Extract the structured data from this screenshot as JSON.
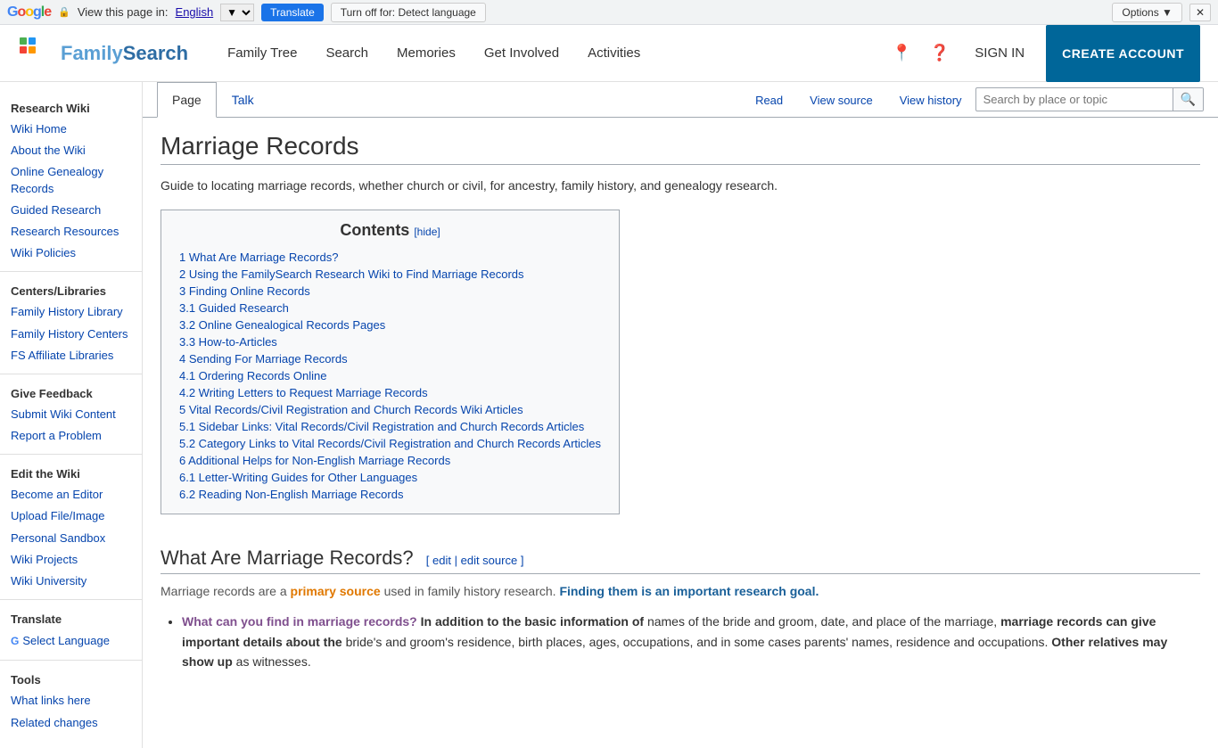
{
  "translate_bar": {
    "view_text": "View this page in:",
    "language": "English",
    "translate_btn": "Translate",
    "turn_off_btn": "Turn off for: Detect language",
    "options_btn": "Options ▼",
    "close_btn": "✕"
  },
  "header": {
    "logo_text": "FamilySearch",
    "nav_items": [
      "Family Tree",
      "Search",
      "Memories",
      "Get Involved",
      "Activities"
    ],
    "sign_in": "SIGN IN",
    "create_account": "CREATE ACCOUNT"
  },
  "sidebar": {
    "sections": [
      {
        "title": "Research Wiki",
        "links": [
          {
            "label": "Wiki Home",
            "href": "#"
          },
          {
            "label": "About the Wiki",
            "href": "#"
          },
          {
            "label": "Online Genealogy Records",
            "href": "#"
          },
          {
            "label": "Guided Research",
            "href": "#"
          },
          {
            "label": "Research Resources",
            "href": "#"
          },
          {
            "label": "Wiki Policies",
            "href": "#"
          }
        ]
      },
      {
        "title": "Centers/Libraries",
        "links": [
          {
            "label": "Family History Library",
            "href": "#"
          },
          {
            "label": "Family History Centers",
            "href": "#"
          },
          {
            "label": "FS Affiliate Libraries",
            "href": "#"
          }
        ]
      },
      {
        "title": "Give Feedback",
        "links": [
          {
            "label": "Submit Wiki Content",
            "href": "#"
          },
          {
            "label": "Report a Problem",
            "href": "#"
          }
        ]
      },
      {
        "title": "Edit the Wiki",
        "links": [
          {
            "label": "Become an Editor",
            "href": "#"
          },
          {
            "label": "Upload File/Image",
            "href": "#"
          },
          {
            "label": "Personal Sandbox",
            "href": "#"
          },
          {
            "label": "Wiki Projects",
            "href": "#"
          },
          {
            "label": "Wiki University",
            "href": "#"
          }
        ]
      },
      {
        "title": "Translate",
        "links": [
          {
            "label": "Select Language",
            "href": "#"
          }
        ]
      },
      {
        "title": "Tools",
        "links": [
          {
            "label": "What links here",
            "href": "#"
          },
          {
            "label": "Related changes",
            "href": "#"
          }
        ]
      }
    ]
  },
  "page_tabs": {
    "left": [
      {
        "label": "Page",
        "active": true
      },
      {
        "label": "Talk",
        "active": false
      }
    ],
    "right": [
      {
        "label": "Read"
      },
      {
        "label": "View source"
      },
      {
        "label": "View history"
      }
    ],
    "search_placeholder": "Search by place or topic"
  },
  "article": {
    "title": "Marriage Records",
    "intro": "Guide to locating marriage records, whether church or civil, for ancestry, family history, and genealogy research.",
    "contents": {
      "title": "Contents",
      "hide_label": "[hide]",
      "items": [
        {
          "num": "1",
          "label": "What Are Marriage Records?",
          "href": "#"
        },
        {
          "num": "2",
          "label": "Using the FamilySearch Research Wiki to Find Marriage Records",
          "href": "#"
        },
        {
          "num": "3",
          "label": "Finding Online Records",
          "href": "#"
        },
        {
          "num": "3.1",
          "label": "Guided Research",
          "href": "#",
          "sub": true
        },
        {
          "num": "3.2",
          "label": "Online Genealogical Records Pages",
          "href": "#",
          "sub": true
        },
        {
          "num": "3.3",
          "label": "How-to-Articles",
          "href": "#",
          "sub": true
        },
        {
          "num": "4",
          "label": "Sending For Marriage Records",
          "href": "#"
        },
        {
          "num": "4.1",
          "label": "Ordering Records Online",
          "href": "#",
          "sub": true
        },
        {
          "num": "4.2",
          "label": "Writing Letters to Request Marriage Records",
          "href": "#",
          "sub": true
        },
        {
          "num": "5",
          "label": "Vital Records/Civil Registration and Church Records Wiki Articles",
          "href": "#"
        },
        {
          "num": "5.1",
          "label": "Sidebar Links: Vital Records/Civil Registration and Church Records Articles",
          "href": "#",
          "sub": true
        },
        {
          "num": "5.2",
          "label": "Category Links to Vital Records/Civil Registration and Church Records Articles",
          "href": "#",
          "sub": true
        },
        {
          "num": "6",
          "label": "Additional Helps for Non-English Marriage Records",
          "href": "#"
        },
        {
          "num": "6.1",
          "label": "Letter-Writing Guides for Other Languages",
          "href": "#",
          "sub": true
        },
        {
          "num": "6.2",
          "label": "Reading Non-English Marriage Records",
          "href": "#",
          "sub": true
        }
      ]
    },
    "what_are_heading": "What Are Marriage Records?",
    "edit_label": "[ edit | edit source ]",
    "intro_para": "Marriage records are a",
    "primary_source": "primary source",
    "intro_para2": "used in family history research.",
    "finding_text": "Finding them is an important research goal.",
    "bullet1_bold": "What can you find in marriage records?",
    "bullet1_bold2": "In addition to the basic information of",
    "bullet1_text": "names of the bride and groom, date, and place of the marriage,",
    "bullet1_cont_bold": "marriage records can give important details about the",
    "bullet1_cont": "bride's and groom's residence, birth places, ages, occupations, and in some cases parents' names, residence and occupations.",
    "bullet1_other_bold": "Other relatives may show up",
    "bullet1_other": "as witnesses."
  }
}
